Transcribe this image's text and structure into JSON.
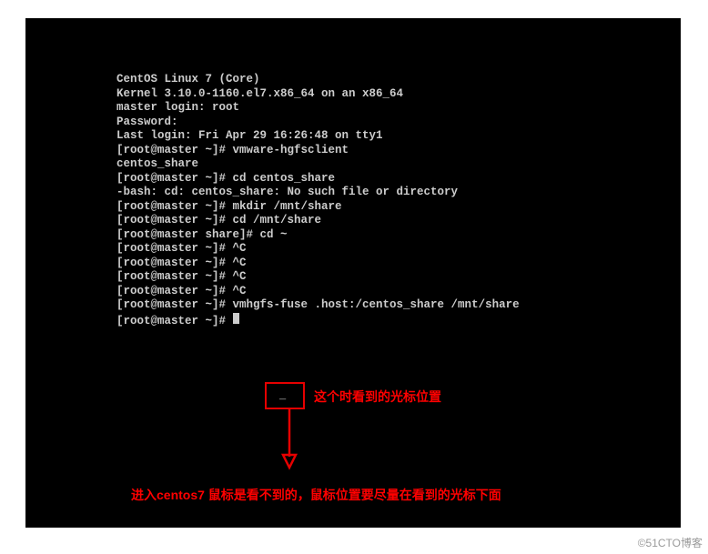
{
  "terminal": {
    "lines": [
      "",
      "",
      "CentOS Linux 7 (Core)",
      "Kernel 3.10.0-1160.el7.x86_64 on an x86_64",
      "",
      "master login: root",
      "Password:",
      "Last login: Fri Apr 29 16:26:48 on tty1",
      "[root@master ~]# vmware-hgfsclient",
      "centos_share",
      "[root@master ~]# cd centos_share",
      "-bash: cd: centos_share: No such file or directory",
      "[root@master ~]# mkdir /mnt/share",
      "[root@master ~]# cd /mnt/share",
      "[root@master share]# cd ~",
      "[root@master ~]# ^C",
      "[root@master ~]# ^C",
      "[root@master ~]# ^C",
      "[root@master ~]# ^C",
      "[root@master ~]# vmhgfs-fuse .host:/centos_share /mnt/share",
      "[root@master ~]# "
    ]
  },
  "annotations": {
    "cursor_mark": "_",
    "right": "这个时看到的光标位置",
    "bottom": "进入centos7 鼠标是看不到的，鼠标位置要尽量在看到的光标下面"
  },
  "watermark": "©51CTO博客"
}
